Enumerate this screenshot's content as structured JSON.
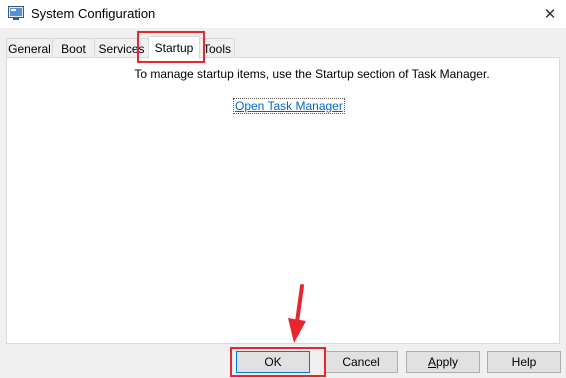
{
  "window": {
    "title": "System Configuration",
    "close_glyph": "✕"
  },
  "tabs": [
    {
      "label": "General",
      "active": false
    },
    {
      "label": "Boot",
      "active": false
    },
    {
      "label": "Services",
      "active": false
    },
    {
      "label": "Startup",
      "active": true
    },
    {
      "label": "Tools",
      "active": false
    }
  ],
  "startup_panel": {
    "message": "To manage startup items, use the Startup section of Task Manager.",
    "link_text": "Open Task Manager"
  },
  "buttons": {
    "ok": "OK",
    "cancel": "Cancel",
    "apply_first": "A",
    "apply_rest": "pply",
    "help": "Help"
  },
  "annotations": {
    "color": "#e8262d",
    "highlighted": [
      "tab-startup",
      "ok-button"
    ]
  },
  "colors": {
    "link": "#0066cc",
    "panel_bg": "#ffffff",
    "window_bg": "#f0f0f0"
  }
}
